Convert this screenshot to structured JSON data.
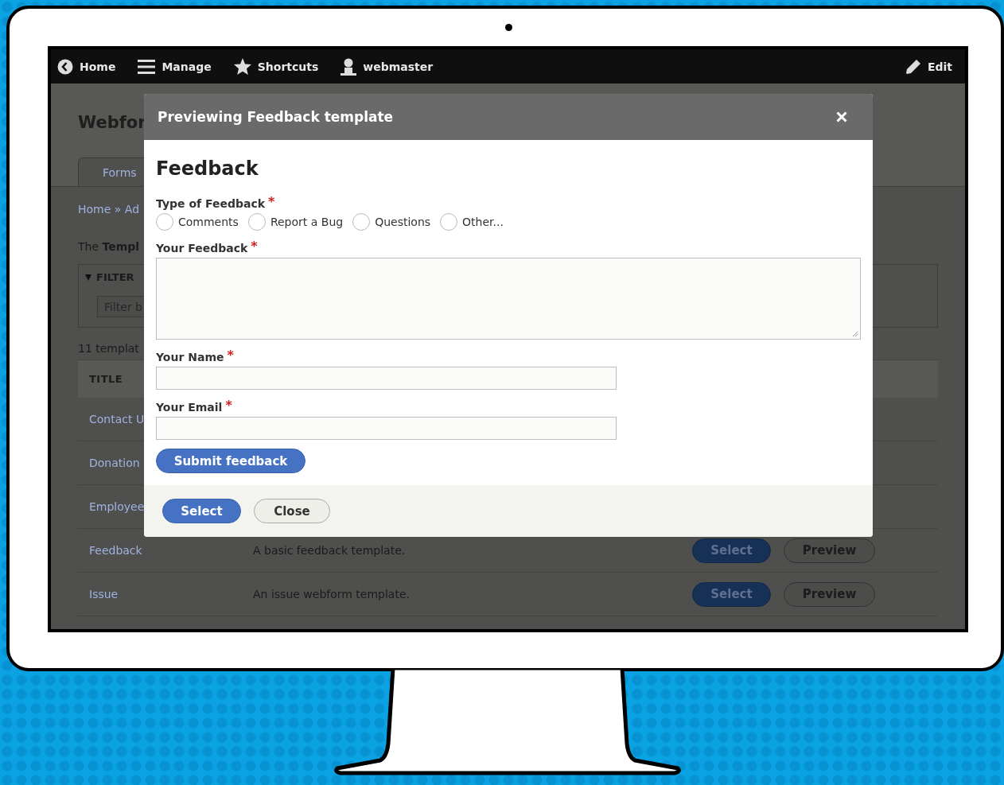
{
  "toolbar": {
    "items": [
      {
        "label": "Home"
      },
      {
        "label": "Manage"
      },
      {
        "label": "Shortcuts"
      },
      {
        "label": "webmaster"
      }
    ],
    "edit": {
      "label": "Edit"
    }
  },
  "page": {
    "title": "Webfor",
    "tabs": [
      {
        "label": "Forms",
        "selected": true
      }
    ],
    "breadcrumb": "Home » Ad",
    "intro": "The **Templ**",
    "filter": {
      "legend": "FILTER",
      "expanded": true,
      "placeholder": "Filter b"
    },
    "count": "11 templat",
    "table": {
      "columns": [
        "TITLE"
      ],
      "rows": [
        {
          "title": "Contact U"
        },
        {
          "title": "Donation"
        },
        {
          "title": "Employee"
        },
        {
          "title": "Feedback",
          "description": "A basic feedback template.",
          "actions": [
            {
              "label": "Select",
              "kind": "primary"
            },
            {
              "label": "Preview",
              "kind": "secondary"
            }
          ]
        },
        {
          "title": "Issue",
          "description": "An issue webform template.",
          "actions": [
            {
              "label": "Select",
              "kind": "primary"
            },
            {
              "label": "Preview",
              "kind": "secondary"
            }
          ]
        }
      ]
    }
  },
  "modal": {
    "title": "Previewing Feedback template",
    "form": {
      "heading": "Feedback",
      "required_mark": "*",
      "fields": [
        {
          "kind": "radios",
          "label": "Type of Feedback",
          "required": true,
          "options": [
            {
              "label": "Comments",
              "selected": false
            },
            {
              "label": "Report a Bug",
              "selected": false
            },
            {
              "label": "Questions",
              "selected": false
            },
            {
              "label": "Other...",
              "selected": false
            }
          ]
        },
        {
          "kind": "textarea",
          "label": "Your Feedback",
          "required": true
        },
        {
          "kind": "text",
          "label": "Your Name",
          "required": true
        },
        {
          "kind": "text",
          "label": "Your Email",
          "required": true
        }
      ],
      "submit": "Submit feedback"
    },
    "buttons": [
      {
        "label": "Select",
        "kind": "primary"
      },
      {
        "label": "Close",
        "kind": "secondary"
      }
    ]
  }
}
